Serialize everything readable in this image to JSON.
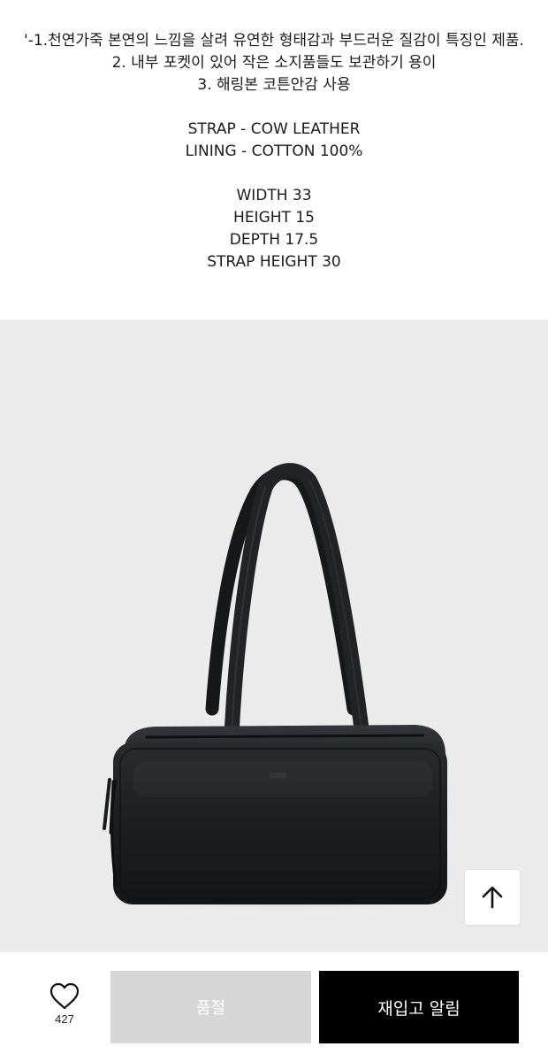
{
  "description": {
    "lines": [
      "'-1.천연가죽 본연의 느낌을 살려 유연한 형태감과 부드러운 질감이 특징인 제품.",
      "2. 내부 포켓이 있어 작은 소지품들도 보관하기 용이",
      "3. 해링본 코튼안감 사용"
    ],
    "materials": [
      "STRAP - COW LEATHER",
      "LINING - COTTON 100%"
    ],
    "dimensions": [
      "WIDTH 33",
      "HEIGHT 15",
      "DEPTH 17.5",
      "STRAP HEIGHT 30"
    ]
  },
  "product_image": {
    "background_color": "#ebebeb",
    "bag_color": "#1c1d1f"
  },
  "scroll_top": {
    "icon": "arrow-up-icon"
  },
  "bottom_bar": {
    "like_icon": "heart-icon",
    "like_count": "427",
    "soldout_label": "품절",
    "restock_label": "재입고 알림"
  }
}
